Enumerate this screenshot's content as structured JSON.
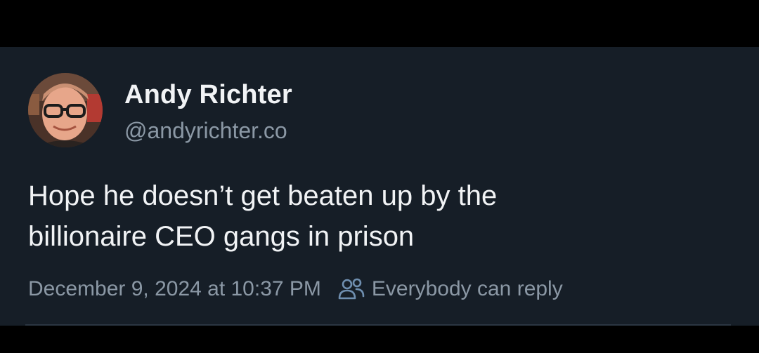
{
  "post": {
    "author_name": "Andy Richter",
    "author_handle": "@andyrichter.co",
    "text_lines": [
      "Hope he doesn’t get beaten up by the",
      "billionaire CEO gangs in prison"
    ],
    "timestamp": "December 9, 2024 at 10:37 PM",
    "reply_setting": "Everybody can reply",
    "reply_icon": "people-icon"
  },
  "colors": {
    "background": "#161e27",
    "primary_text": "#f1f3f5",
    "secondary_text": "#8b98a5",
    "icon_accent": "#6f8fb0"
  }
}
